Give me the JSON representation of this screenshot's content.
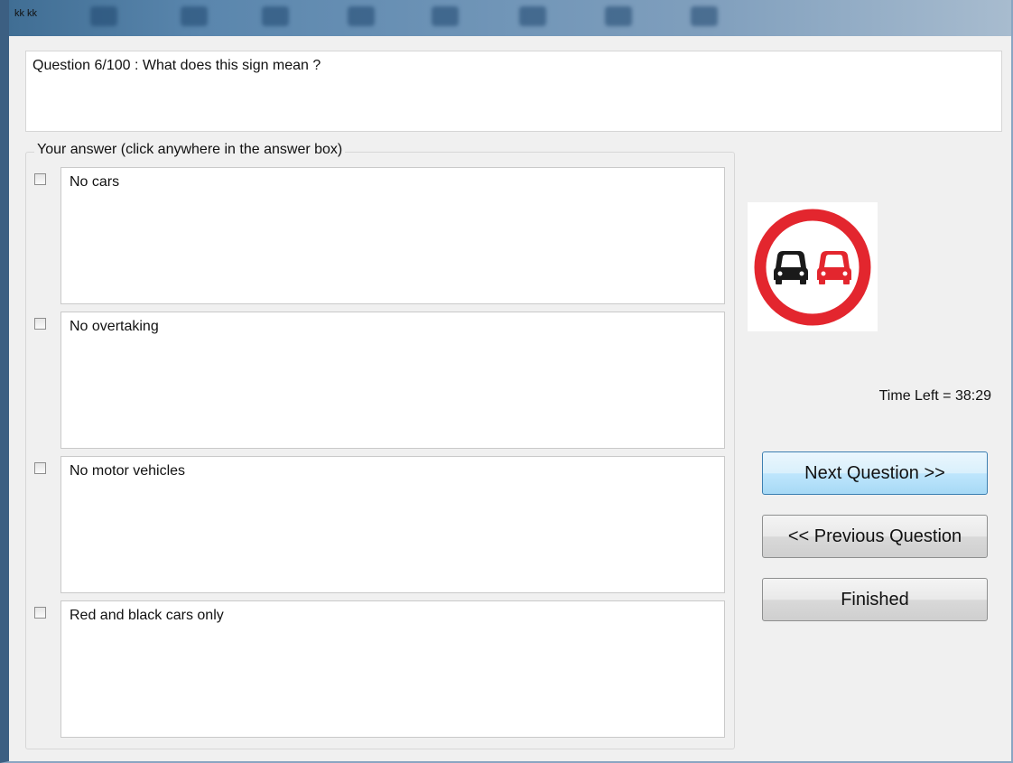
{
  "window": {
    "title": "kk kk"
  },
  "question": {
    "text": "Question 6/100 : What does this sign mean ?"
  },
  "answers_group": {
    "title": "Your answer (click anywhere in the answer box)",
    "options": [
      {
        "text": "No cars",
        "checked": false
      },
      {
        "text": "No overtaking",
        "checked": false
      },
      {
        "text": "No motor vehicles",
        "checked": false
      },
      {
        "text": "Red and black cars only",
        "checked": false
      }
    ]
  },
  "sign": {
    "icon": "no-overtaking-sign",
    "ring_color": "#e3262e",
    "left_car_color": "#1a1a1a",
    "right_car_color": "#e3262e"
  },
  "timer": {
    "text": "Time Left = 38:29"
  },
  "buttons": {
    "next": "Next Question >>",
    "previous": "<< Previous Question",
    "finished": "Finished"
  }
}
